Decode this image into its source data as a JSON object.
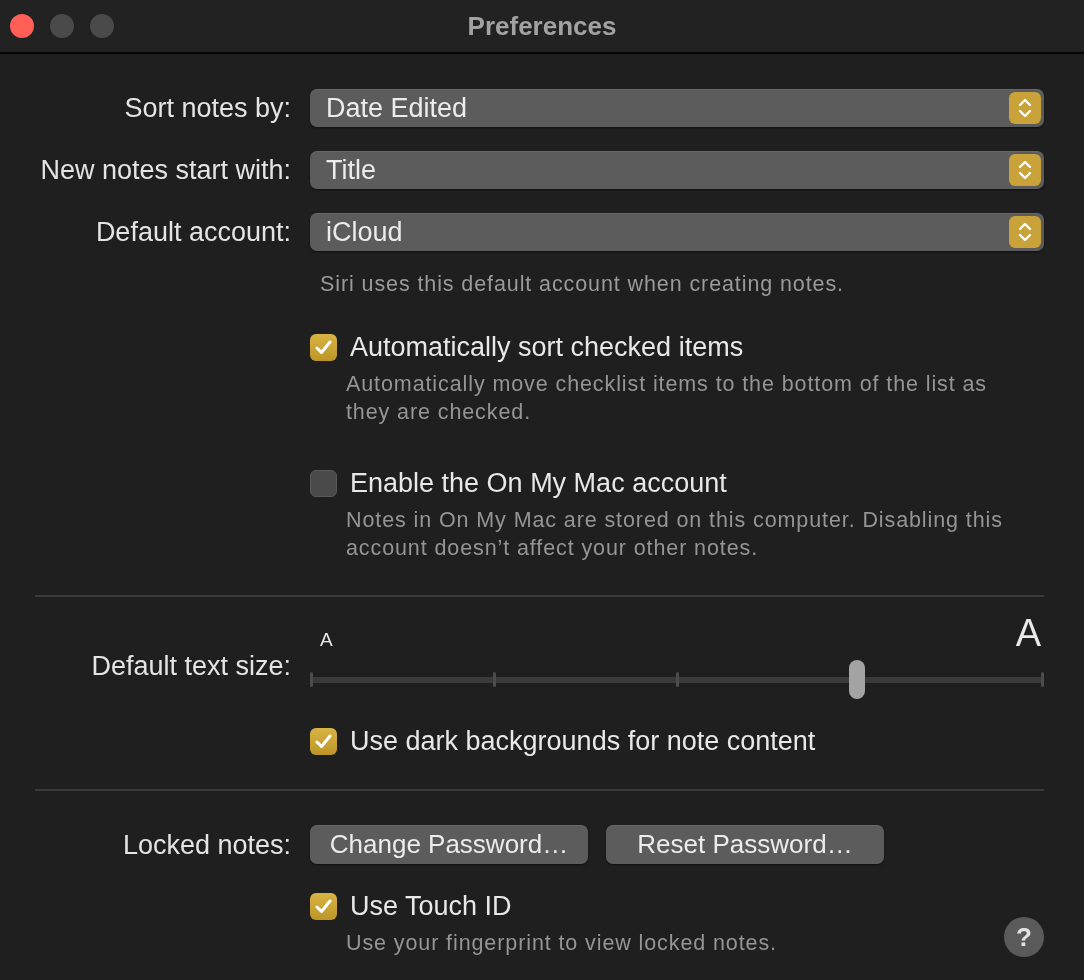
{
  "window": {
    "title": "Preferences",
    "controls": [
      {
        "kind": "close",
        "disabled": false
      },
      {
        "kind": "minimize",
        "disabled": true
      },
      {
        "kind": "zoom",
        "disabled": true
      }
    ]
  },
  "popups": [
    {
      "label": "Sort notes by:",
      "value": "Date Edited"
    },
    {
      "label": "New notes start with:",
      "value": "Title"
    },
    {
      "label": "Default account:",
      "value": "iCloud"
    }
  ],
  "account_note": "Siri uses this default account when creating notes.",
  "options": [
    {
      "label": "Automatically sort checked items",
      "description": "Automatically move checklist items to the bottom of the list as they are checked.",
      "checked": true
    },
    {
      "label": "Enable the On My Mac account",
      "description": "Notes in On My Mac are stored on this computer. Disabling this account doesn’t affect your other notes.",
      "checked": false
    }
  ],
  "text_size": {
    "label": "Default text size:",
    "small_marker": "A",
    "large_marker": "A",
    "level": 0.75,
    "option": {
      "label": "Use dark backgrounds for note content",
      "checked": true
    }
  },
  "locked_notes": {
    "label": "Locked notes:",
    "buttons": [
      "Change Password…",
      "Reset Password…"
    ],
    "option": {
      "label": "Use Touch ID",
      "description": "Use your fingerprint to view locked notes.",
      "checked": true
    }
  },
  "help_button": {
    "label": "?"
  }
}
